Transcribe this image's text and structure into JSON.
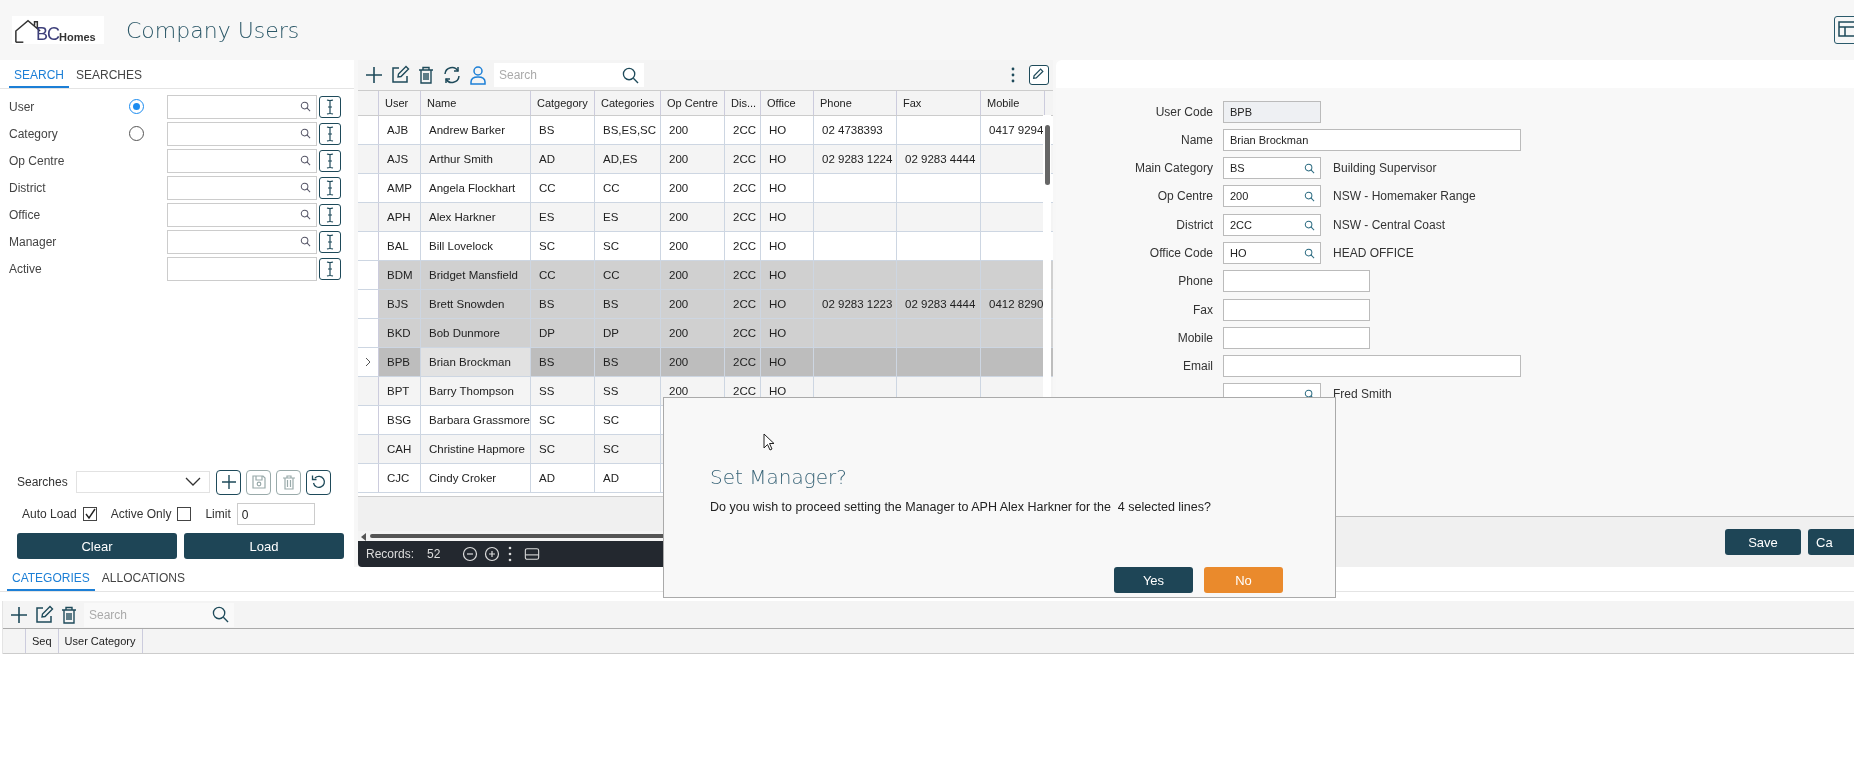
{
  "header": {
    "logo_letters": "BC",
    "logo_word": "Homes",
    "title": "Company Users"
  },
  "search_panel": {
    "tabs": [
      {
        "label": "SEARCH",
        "selected": true
      },
      {
        "label": "SEARCHES",
        "selected": false
      }
    ],
    "fields": [
      {
        "label": "User",
        "kind": "radio-lookup",
        "selected": true
      },
      {
        "label": "Category",
        "kind": "radio-lookup",
        "selected": false
      },
      {
        "label": "Op Centre",
        "kind": "lookup"
      },
      {
        "label": "District",
        "kind": "lookup"
      },
      {
        "label": "Office",
        "kind": "lookup"
      },
      {
        "label": "Manager",
        "kind": "lookup"
      },
      {
        "label": "Active",
        "kind": "plain"
      }
    ],
    "searches_label": "Searches",
    "options": [
      {
        "label": "Auto Load",
        "checked": true
      },
      {
        "label": "Active Only",
        "checked": false
      }
    ],
    "limit": {
      "label": "Limit",
      "value": "0"
    },
    "buttons": [
      "Clear",
      "Load"
    ]
  },
  "grid": {
    "search_placeholder": "Search",
    "columns": [
      "User",
      "Name",
      "Catgegory",
      "Categories",
      "Op Centre",
      "Dis...",
      "Office",
      "Phone",
      "Fax",
      "Mobile"
    ],
    "rows": [
      {
        "cells": [
          "AJB",
          "Andrew Barker",
          "BS",
          "BS,ES,SC",
          "200",
          "2CC",
          "HO",
          "02 4738393",
          "",
          "0417 9294"
        ],
        "selected": false,
        "current": false
      },
      {
        "cells": [
          "AJS",
          "Arthur Smith",
          "AD",
          "AD,ES",
          "200",
          "2CC",
          "HO",
          "02 9283 1224",
          "02 9283 4444",
          ""
        ],
        "selected": false,
        "current": false
      },
      {
        "cells": [
          "AMP",
          "Angela Flockhart",
          "CC",
          "CC",
          "200",
          "2CC",
          "HO",
          "",
          "",
          ""
        ],
        "selected": false,
        "current": false
      },
      {
        "cells": [
          "APH",
          "Alex Harkner",
          "ES",
          "ES",
          "200",
          "2CC",
          "HO",
          "",
          "",
          ""
        ],
        "selected": false,
        "current": false
      },
      {
        "cells": [
          "BAL",
          "Bill Lovelock",
          "SC",
          "SC",
          "200",
          "2CC",
          "HO",
          "",
          "",
          ""
        ],
        "selected": false,
        "current": false
      },
      {
        "cells": [
          "BDM",
          "Bridget Mansfield",
          "CC",
          "CC",
          "200",
          "2CC",
          "HO",
          "",
          "",
          ""
        ],
        "selected": true,
        "current": false
      },
      {
        "cells": [
          "BJS",
          "Brett Snowden",
          "BS",
          "BS",
          "200",
          "2CC",
          "HO",
          "02 9283 1223",
          "02 9283 4444",
          "0412 8290"
        ],
        "selected": true,
        "current": false
      },
      {
        "cells": [
          "BKD",
          "Bob Dunmore",
          "DP",
          "DP",
          "200",
          "2CC",
          "HO",
          "",
          "",
          ""
        ],
        "selected": true,
        "current": false
      },
      {
        "cells": [
          "BPB",
          "Brian Brockman",
          "BS",
          "BS",
          "200",
          "2CC",
          "HO",
          "",
          "",
          ""
        ],
        "selected": true,
        "current": true
      },
      {
        "cells": [
          "BPT",
          "Barry Thompson",
          "SS",
          "SS",
          "200",
          "2CC",
          "HO",
          "",
          "",
          ""
        ],
        "selected": false,
        "current": false
      },
      {
        "cells": [
          "BSG",
          "Barbara Grassmore",
          "SC",
          "SC"
        ],
        "selected": false,
        "current": false
      },
      {
        "cells": [
          "CAH",
          "Christine Hapmore",
          "SC",
          "SC"
        ],
        "selected": false,
        "current": false
      },
      {
        "cells": [
          "CJC",
          "Cindy Croker",
          "AD",
          "AD"
        ],
        "selected": false,
        "current": false
      }
    ],
    "records_label": "Records:",
    "records_count": "52"
  },
  "details": {
    "fields": [
      {
        "label": "User Code",
        "kind": "readonly",
        "value": "BPB"
      },
      {
        "label": "Name",
        "kind": "long",
        "value": "Brian Brockman"
      },
      {
        "label": "Main Category",
        "kind": "lookup",
        "value": "BS",
        "description": "Building Supervisor"
      },
      {
        "label": "Op Centre",
        "kind": "lookup",
        "value": "200",
        "description": "NSW - Homemaker Range"
      },
      {
        "label": "District",
        "kind": "lookup",
        "value": "2CC",
        "description": "NSW - Central Coast"
      },
      {
        "label": "Office Code",
        "kind": "lookup",
        "value": "HO",
        "description": "HEAD OFFICE"
      },
      {
        "label": "Phone",
        "kind": "medium"
      },
      {
        "label": "Fax",
        "kind": "medium"
      },
      {
        "label": "Mobile",
        "kind": "medium"
      },
      {
        "label": "Email",
        "kind": "long"
      },
      {
        "kind": "lookup",
        "description": "Fred Smith"
      }
    ],
    "buttons": [
      "Save",
      "Ca"
    ]
  },
  "bottom": {
    "tabs": [
      {
        "label": "CATEGORIES",
        "selected": true
      },
      {
        "label": "ALLOCATIONS",
        "selected": false
      }
    ],
    "search_placeholder": "Search",
    "columns": [
      "Seq",
      "User Category"
    ]
  },
  "dialog": {
    "title": "Set Manager?",
    "message": "Do you wish to proceed setting the Manager to APH Alex Harkner for the  4 selected lines?",
    "buttons": [
      {
        "label": "Yes",
        "kind": "primary"
      },
      {
        "label": "No",
        "kind": "warning"
      }
    ]
  }
}
